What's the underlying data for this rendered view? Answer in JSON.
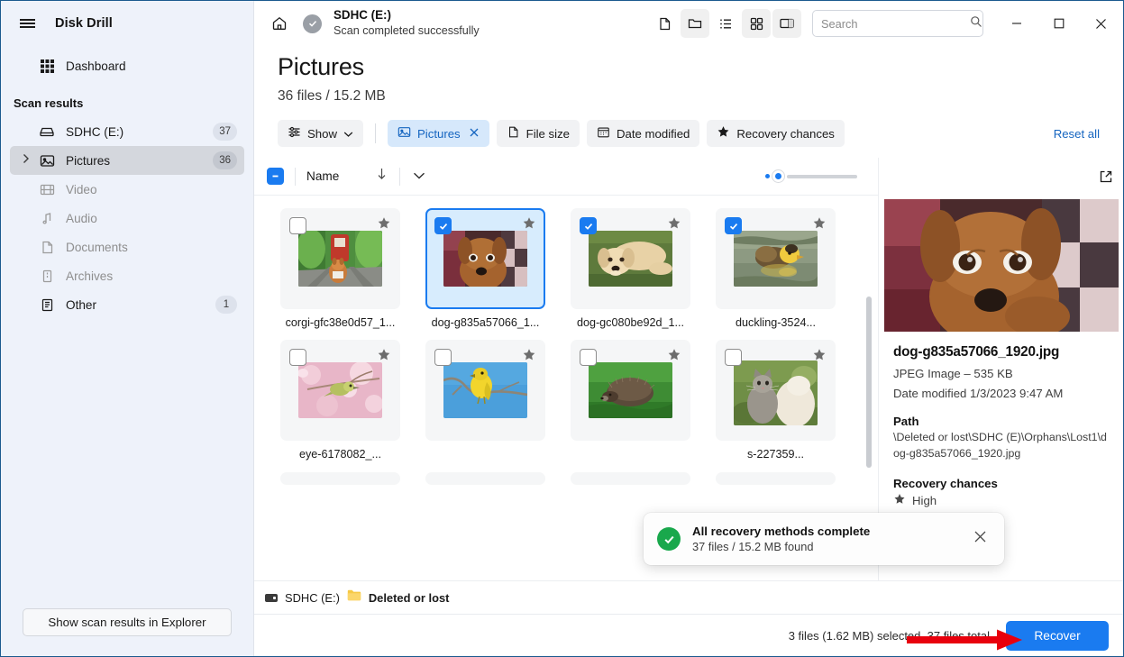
{
  "app": {
    "title": "Disk Drill",
    "menu_icon": "hamburger-icon"
  },
  "sidebar": {
    "dashboard": {
      "label": "Dashboard",
      "icon": "grid-icon"
    },
    "section_label": "Scan results",
    "items": [
      {
        "label": "SDHC (E:)",
        "icon": "drive-icon",
        "badge": "37",
        "dimmed": false,
        "selected": false,
        "expandable": false
      },
      {
        "label": "Pictures",
        "icon": "picture-icon",
        "badge": "36",
        "dimmed": false,
        "selected": true,
        "expandable": true
      },
      {
        "label": "Video",
        "icon": "film-icon",
        "badge": "",
        "dimmed": true,
        "selected": false,
        "expandable": false
      },
      {
        "label": "Audio",
        "icon": "music-note-icon",
        "badge": "",
        "dimmed": true,
        "selected": false,
        "expandable": false
      },
      {
        "label": "Documents",
        "icon": "document-icon",
        "badge": "",
        "dimmed": true,
        "selected": false,
        "expandable": false
      },
      {
        "label": "Archives",
        "icon": "archive-icon",
        "badge": "",
        "dimmed": true,
        "selected": false,
        "expandable": false
      },
      {
        "label": "Other",
        "icon": "list-document-icon",
        "badge": "1",
        "dimmed": false,
        "selected": false,
        "expandable": false
      }
    ],
    "explorer_button": "Show scan results in Explorer"
  },
  "titlebar": {
    "home_icon": "home-icon",
    "status_icon": "check-circle-icon",
    "scan_title": "SDHC (E:)",
    "scan_subtitle": "Scan completed successfully",
    "view_buttons": [
      {
        "name": "file-view-icon",
        "active": false
      },
      {
        "name": "folder-view-icon",
        "active": true
      },
      {
        "name": "list-view-icon",
        "active": false
      },
      {
        "name": "grid-view-icon",
        "active": true
      },
      {
        "name": "preview-pane-icon",
        "active": true
      }
    ],
    "search_placeholder": "Search",
    "search_value": "",
    "window_minimize": "minimize-icon",
    "window_maximize": "maximize-icon",
    "window_close": "close-icon"
  },
  "page": {
    "title": "Pictures",
    "subtitle": "36 files / 15.2 MB"
  },
  "filters": {
    "show_label": "Show",
    "chips": [
      {
        "label": "Pictures",
        "icon": "picture-icon",
        "active": true,
        "closable": true
      },
      {
        "label": "File size",
        "icon": "file-icon",
        "active": false,
        "closable": false
      },
      {
        "label": "Date modified",
        "icon": "calendar-icon",
        "active": false,
        "closable": false
      },
      {
        "label": "Recovery chances",
        "icon": "star-icon",
        "active": false,
        "closable": false
      }
    ],
    "reset_label": "Reset all"
  },
  "list_header": {
    "select_all_state": "indeterminate",
    "name_label": "Name",
    "sort_icon": "arrow-down-icon",
    "chevron_icon": "chevron-down-icon",
    "zoom_slider_value": 8
  },
  "files": [
    {
      "name": "corgi-gfc38e0d57_1...",
      "checked": false,
      "selected": false,
      "starred": true,
      "thumb": "corgi-on-tracks"
    },
    {
      "name": "dog-g835a57066_1...",
      "checked": true,
      "selected": true,
      "starred": true,
      "thumb": "brown-puppy-blanket"
    },
    {
      "name": "dog-gc080be92d_1...",
      "checked": true,
      "selected": false,
      "starred": true,
      "thumb": "golden-retriever-puppy"
    },
    {
      "name": "duckling-3524...",
      "checked": true,
      "selected": false,
      "starred": true,
      "thumb": "duckling-water"
    },
    {
      "name": "eye-6178082_...",
      "checked": false,
      "selected": false,
      "starred": true,
      "thumb": "bird-blossom"
    },
    {
      "name": "",
      "checked": false,
      "selected": false,
      "starred": true,
      "thumb": "yellow-bird-branch"
    },
    {
      "name": "",
      "checked": false,
      "selected": false,
      "starred": true,
      "thumb": "hedgehog-grass"
    },
    {
      "name": "s-227359...",
      "checked": false,
      "selected": false,
      "starred": true,
      "thumb": "kittens-grass"
    }
  ],
  "detail": {
    "open_external_icon": "open-external-icon",
    "preview_thumb": "brown-puppy-blanket",
    "filename": "dog-g835a57066_1920.jpg",
    "filetype": "JPEG Image – 535 KB",
    "date_modified": "Date modified 1/3/2023 9:47 AM",
    "path_label": "Path",
    "path_value": "\\Deleted or lost\\SDHC (E)\\Orphans\\Lost1\\dog-g835a57066_1920.jpg",
    "recovery_label": "Recovery chances",
    "recovery_value": "High",
    "recovery_icon": "star-icon"
  },
  "statusbar": {
    "drive_icon": "drive-icon",
    "drive_label": "SDHC (E:)",
    "folder_icon": "folder-icon",
    "folder_label": "Deleted or lost"
  },
  "bottombar": {
    "selection_text": "3 files (1.62 MB) selected, 37 files total",
    "recover_label": "Recover"
  },
  "toast": {
    "icon": "check-circle-green-icon",
    "title": "All recovery methods complete",
    "subtitle": "37 files / 15.2 MB found",
    "close_icon": "close-icon"
  },
  "annotation": {
    "type": "red-arrow",
    "color": "#e8000d"
  }
}
